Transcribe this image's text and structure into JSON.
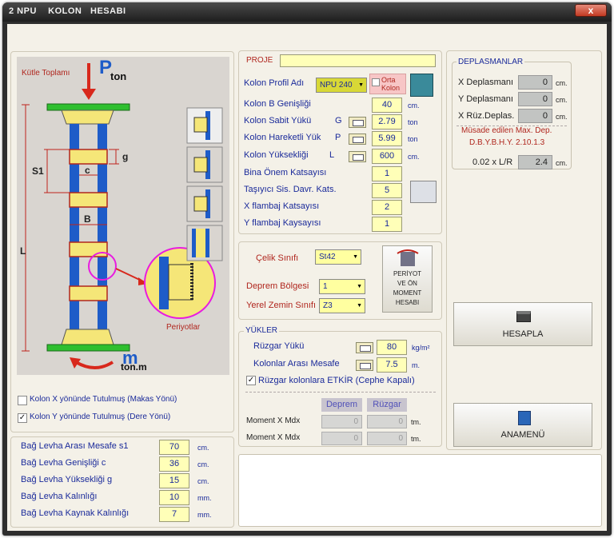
{
  "window": {
    "title": "2 NPU    KOLON   HESABI",
    "close": "x"
  },
  "diagram": {
    "mass_label": "Kütle Toplamı",
    "p_label": "P",
    "p_sub": "ton",
    "g": "g",
    "c": "c",
    "s1": "S1",
    "b": "B",
    "l": "L",
    "m": "m",
    "m_sub": "ton.m",
    "periyotlar": "Periyotlar"
  },
  "restraints": [
    {
      "label": "Kolon X yönünde Tutulmuş  (Makas Yönü)",
      "checked": false
    },
    {
      "label": "Kolon Y yönünde Tutulmuş    (Dere Yönü)",
      "checked": true
    }
  ],
  "plates": [
    {
      "label": "Bağ Levha Arası Mesafe  s1",
      "value": "70",
      "unit": "cm."
    },
    {
      "label": "Bağ  Levha Genişliği      c",
      "value": "36",
      "unit": "cm."
    },
    {
      "label": "Bağ  Levha Yüksekliği   g",
      "value": "15",
      "unit": "cm."
    },
    {
      "label": "Bağ  Levha   Kalınlığı",
      "value": "10",
      "unit": "mm."
    },
    {
      "label": "Bağ Levha Kaynak Kalınlığı",
      "value": "7",
      "unit": "mm."
    }
  ],
  "proje": {
    "label": "PROJE",
    "value": ""
  },
  "profile": {
    "label": "Kolon Profil Adı",
    "value": "NPU 240",
    "orta_kolon": "Orta Kolon"
  },
  "column_fields": [
    {
      "label": "Kolon B Genişliği",
      "sym": "",
      "value": "40",
      "unit": "cm."
    },
    {
      "label": "Kolon Sabit Yükü",
      "sym": "G",
      "value": "2.79",
      "unit": "ton"
    },
    {
      "label": "Kolon Hareketli Yük",
      "sym": "P",
      "value": "5.99",
      "unit": "ton"
    },
    {
      "label": "Kolon Yüksekliği",
      "sym": "L",
      "value": "600",
      "unit": "cm."
    },
    {
      "label": "Bina Önem Katsayısı",
      "sym": "",
      "value": "1",
      "unit": ""
    },
    {
      "label": "Taşıyıcı Sis. Davr. Kats.",
      "sym": "",
      "value": "5",
      "unit": ""
    },
    {
      "label": "X flambaj Katsayısı",
      "sym": "",
      "value": "2",
      "unit": ""
    },
    {
      "label": "Y flambaj Kaysayısı",
      "sym": "",
      "value": "1",
      "unit": ""
    }
  ],
  "seismic": {
    "steel_label": "Çelik Sınıfı",
    "steel_value": "St42",
    "zone_label": "Deprem Bölgesi",
    "zone_value": "1",
    "soil_label": "Yerel Zemin Sınıfı",
    "soil_value": "Z3",
    "period_button": [
      "PERİYOT",
      "VE  ÖN",
      "MOMENT",
      "HESABI"
    ]
  },
  "loads": {
    "legend": "YÜKLER",
    "wind_label": "Rüzgar Yükü",
    "wind_value": "80",
    "wind_unit": "kg/m²",
    "spacing_label": "Kolonlar Arası Mesafe",
    "spacing_value": "7.5",
    "spacing_unit": "m.",
    "wind_effect_label": "Rüzgar kolonlara ETKİR (Cephe Kapalı)",
    "wind_effect_checked": true,
    "col_deprem": "Deprem",
    "col_ruzgar": "Rüzgar",
    "moments": [
      {
        "label": "Moment X   Mdx",
        "deprem": "0",
        "ruzgar": "0",
        "unit": "tm."
      },
      {
        "label": "Moment X   Mdx",
        "deprem": "0",
        "ruzgar": "0",
        "unit": "tm."
      }
    ]
  },
  "deflections": {
    "legend": "DEPLASMANLAR",
    "rows": [
      {
        "label": "X Deplasmanı",
        "value": "0",
        "unit": "cm."
      },
      {
        "label": "Y Deplasmanı",
        "value": "0",
        "unit": "cm."
      },
      {
        "label": "X Rüz.Deplas.",
        "value": "0",
        "unit": "cm."
      }
    ],
    "allowed_line1": "Müsade edilen Max. Dep.",
    "allowed_line2": "D.B.Y.B.H.Y.  2.10.1.3",
    "limit_label": "0.02 x L/R",
    "limit_value": "2.4",
    "limit_unit": "cm."
  },
  "buttons": {
    "hesapla": "HESAPLA",
    "anamenu": "ANAMENÜ"
  },
  "colors": {
    "column_blue": "#1e5cc8",
    "plate_yellow": "#f5e678",
    "accent_red": "#b0261e",
    "flange_green": "#2fbf2f",
    "zoom_magenta": "#e81ce0"
  }
}
